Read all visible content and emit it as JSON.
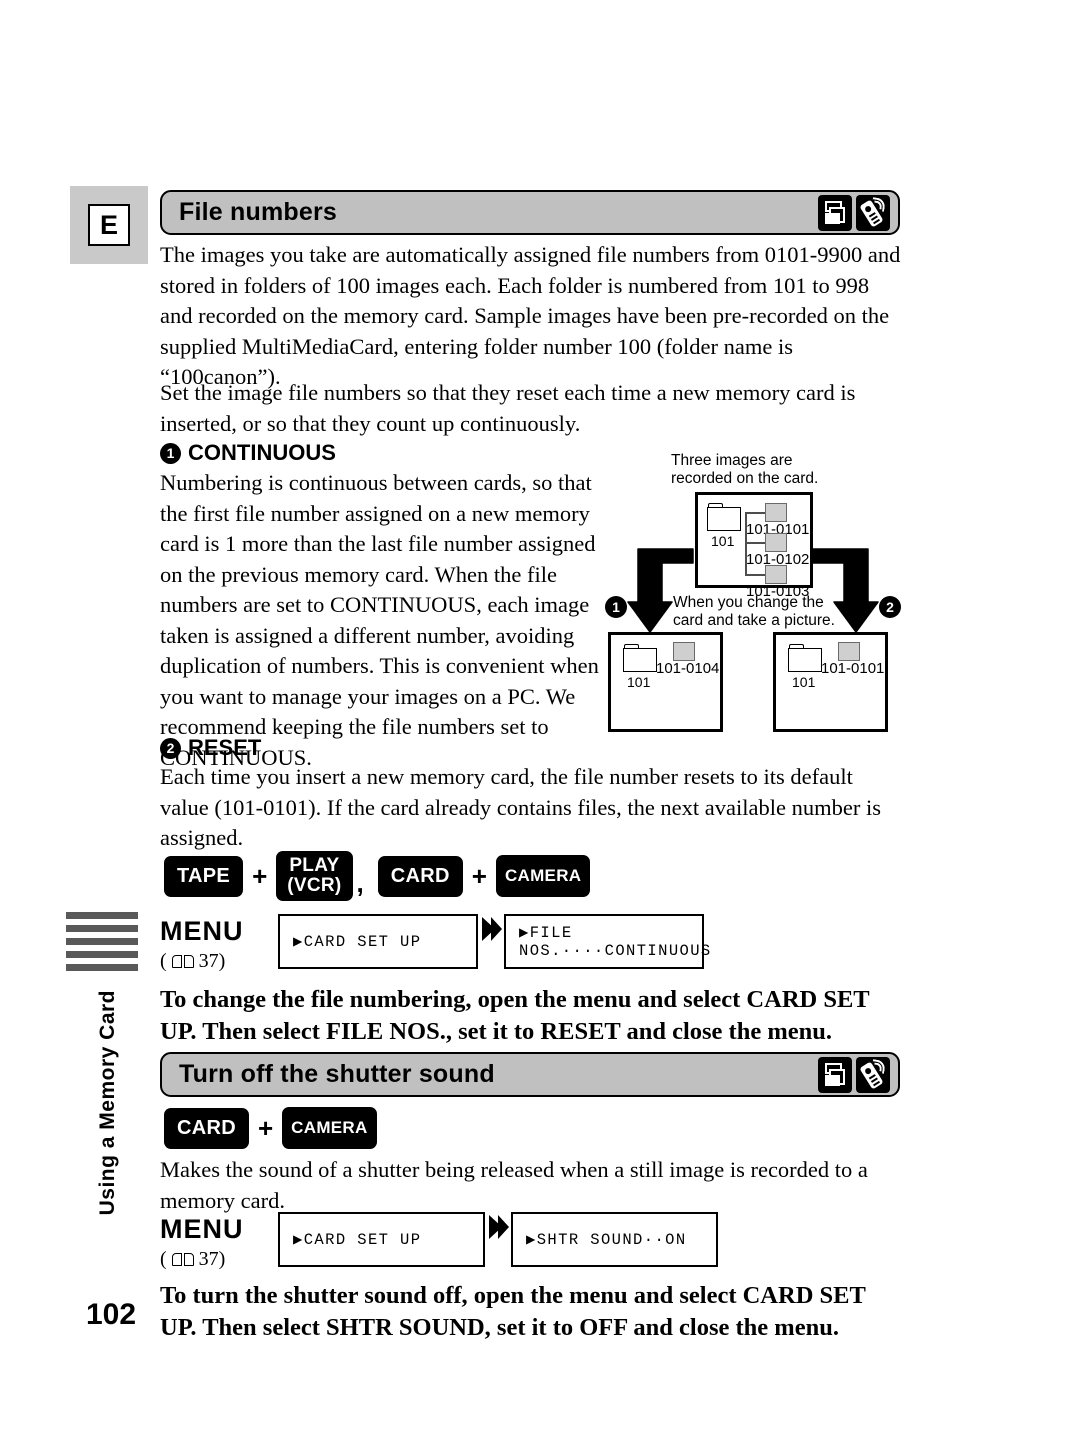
{
  "chapter_tab": {
    "letter": "E"
  },
  "sidebar": {
    "vertical_label": "Using a Memory Card",
    "page_number": "102"
  },
  "sections": [
    {
      "id": "file-numbers",
      "title": "File numbers",
      "icons": [
        "card-camcorder-icon",
        "remote-control-icon"
      ]
    },
    {
      "id": "shutter-sound",
      "title": "Turn off the shutter sound",
      "icons": [
        "card-camcorder-icon",
        "remote-control-icon"
      ]
    }
  ],
  "paragraphs": {
    "intro": "The images you take are automatically assigned file numbers from 0101-9900 and stored in folders of 100 images each. Each folder is numbered from 101 to 998 and recorded on the memory card. Sample images have been pre-recorded on the supplied MultiMediaCard, entering folder number 100 (folder name is “100canon”).",
    "set_numbers": "Set the image file numbers so that they reset each time a new memory card is inserted, or so that they count up continuously.",
    "continuous_body": "Numbering is continuous between cards, so that the first file number assigned on a new memory card is 1 more than the last file number assigned on the previous memory card. When the file numbers are set to CONTINUOUS, each image taken is assigned a different number, avoiding duplication of numbers. This is convenient when you want to manage your images on a PC. We recommend keeping the file numbers set to CONTINUOUS.",
    "reset_body": "Each time you insert a new memory card, the file number resets to its default value (101-0101). If the card already contains files, the next available number is assigned.",
    "shutter_body": "Makes the sound of a shutter being released when a still image is recorded to a memory card."
  },
  "subheads": {
    "continuous": {
      "bullet": "1",
      "label": "CONTINUOUS"
    },
    "reset": {
      "bullet": "2",
      "label": "RESET"
    }
  },
  "instructions": {
    "file_numbers": "To change the file numbering, open the menu and select CARD SET UP. Then select FILE NOS., set it to RESET and close the menu.",
    "shutter_sound": "To turn the shutter sound off, open the menu and select CARD SET UP. Then select SHTR SOUND, set it to OFF and close the menu."
  },
  "mode_buttons_file": {
    "tape": "TAPE",
    "plus1": "+",
    "play_line1": "PLAY",
    "play_line2": "(VCR)",
    "separator": ",",
    "card": "CARD",
    "plus2": "+",
    "camera": "CAMERA"
  },
  "mode_buttons_shutter": {
    "card": "CARD",
    "plus": "+",
    "camera": "CAMERA"
  },
  "menu_file_numbers": {
    "menu_word": "MENU",
    "ref_open": "(",
    "ref_page": "37)",
    "book_icon": "open-book-icon",
    "screen1": "▶CARD SET UP",
    "arrow": "double-chevron-right-icon",
    "screen2": "▶FILE NOS.····CONTINUOUS"
  },
  "menu_shutter_sound": {
    "menu_word": "MENU",
    "ref_open": "(",
    "ref_page": "37)",
    "book_icon": "open-book-icon",
    "screen1": "▶CARD SET UP",
    "arrow": "double-chevron-right-icon",
    "screen2": "▶SHTR SOUND··ON"
  },
  "diagram": {
    "caption_top": "Three images are\nrecorded on the card.",
    "caption_mid": "When you change the\ncard and take a picture.",
    "top_card": {
      "folder": "101",
      "files": [
        "101-0101",
        "101-0102",
        "101-0103"
      ]
    },
    "left_card": {
      "bullet": "1",
      "folder": "101",
      "file": "101-0104"
    },
    "right_card": {
      "bullet": "2",
      "folder": "101",
      "file": "101-0101"
    }
  },
  "colors": {
    "header_bar": "#c0c0c0",
    "tab_gray": "#c9c9c9",
    "bar_gray": "#595959",
    "thumb_gray": "#cfcfcf",
    "ink": "#000000"
  }
}
